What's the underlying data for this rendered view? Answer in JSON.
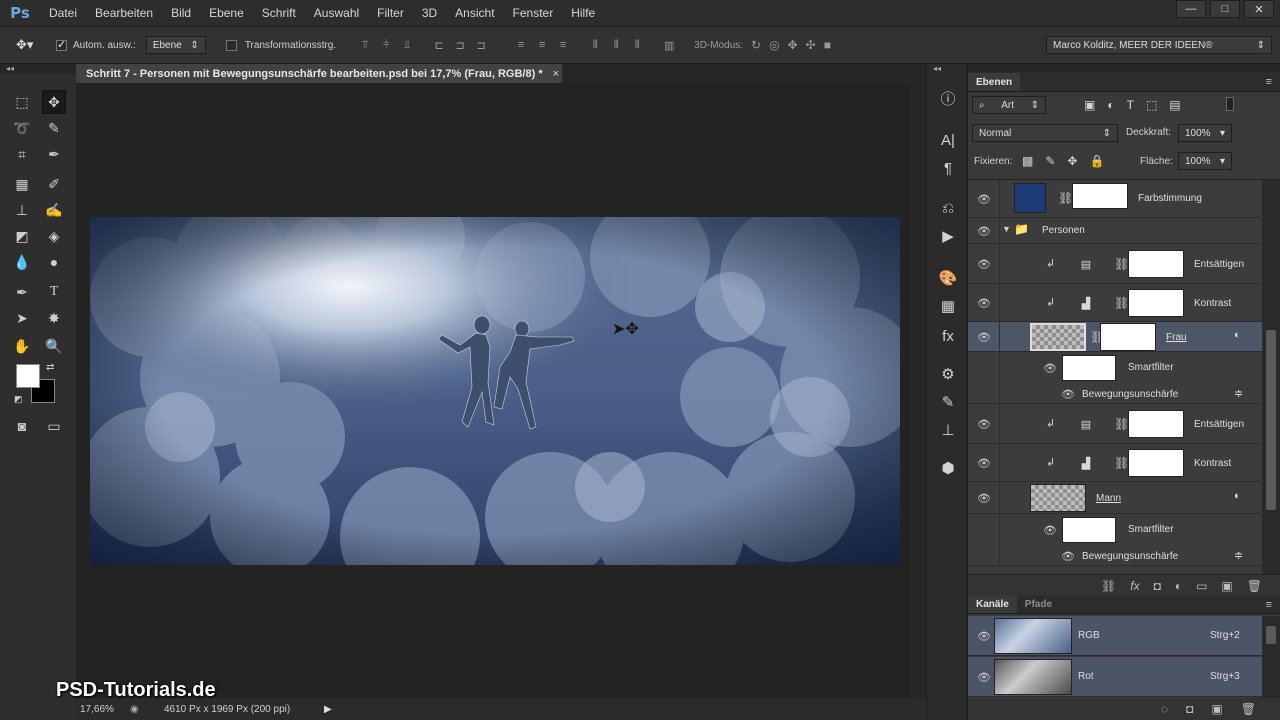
{
  "app": {
    "logo": "Ps"
  },
  "menu": [
    "Datei",
    "Bearbeiten",
    "Bild",
    "Ebene",
    "Schrift",
    "Auswahl",
    "Filter",
    "3D",
    "Ansicht",
    "Fenster",
    "Hilfe"
  ],
  "window_controls": {
    "minimize": "—",
    "maximize": "□",
    "close": "✕"
  },
  "options": {
    "auto_select_label": "Autom. ausw.:",
    "auto_select_value": "Ebene",
    "transform_label": "Transformationsstrg.",
    "mode3d_label": "3D-Modus:",
    "workspace": "Marco Kolditz, MEER DER IDEEN®"
  },
  "document": {
    "tab_title": "Schritt 7 - Personen mit Bewegungsunschärfe bearbeiten.psd bei 17,7% (Frau, RGB/8) *",
    "tab_close": "×"
  },
  "status": {
    "zoom": "17,66%",
    "size": "4610 Px x 1969 Px (200 ppi)"
  },
  "watermark": "PSD-Tutorials.de",
  "layers_panel": {
    "tab": "Ebenen",
    "filter_kind": "Art",
    "blend_mode": "Normal",
    "opacity_label": "Deckkraft:",
    "opacity_value": "100%",
    "lock_label": "Fixieren:",
    "fill_label": "Fläche:",
    "fill_value": "100%",
    "layers": [
      {
        "name": "Farbstimmung",
        "type": "fill"
      },
      {
        "name": "Personen",
        "type": "group"
      },
      {
        "name": "Entsättigen",
        "type": "adjust"
      },
      {
        "name": "Kontrast",
        "type": "adjust"
      },
      {
        "name": "Frau",
        "type": "smart"
      },
      {
        "name": "Smartfilter",
        "type": "filtermask"
      },
      {
        "name": "Bewegungsunschärfe",
        "type": "filter"
      },
      {
        "name": "Entsättigen",
        "type": "adjust"
      },
      {
        "name": "Kontrast",
        "type": "adjust"
      },
      {
        "name": "Mann",
        "type": "smart"
      },
      {
        "name": "Smartfilter",
        "type": "filtermask"
      },
      {
        "name": "Bewegungsunschärfe",
        "type": "filter"
      }
    ]
  },
  "channels_panel": {
    "tabs": [
      "Kanäle",
      "Pfade"
    ],
    "channels": [
      {
        "name": "RGB",
        "shortcut": "Strg+2"
      },
      {
        "name": "Rot",
        "shortcut": "Strg+3"
      }
    ]
  },
  "colors": {
    "fill_swatch": "#1f3a78",
    "selected_row": "#4c5666"
  }
}
